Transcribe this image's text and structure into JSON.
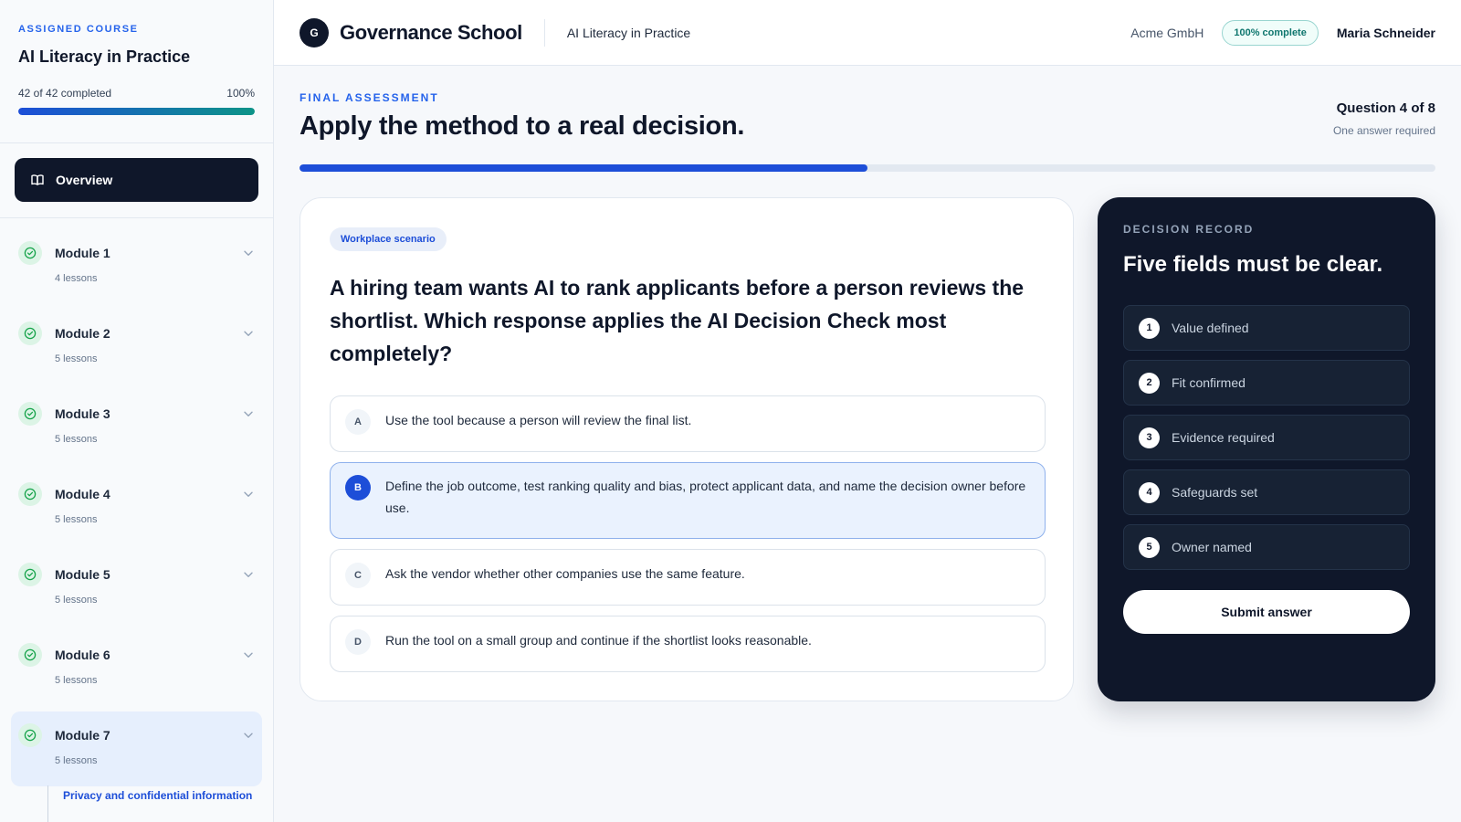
{
  "sidebar": {
    "eyebrow": "ASSIGNED COURSE",
    "course_title": "AI Literacy in Practice",
    "progress_text": "42 of 42 completed",
    "progress_percent_text": "100%",
    "progress_fraction": 1.0,
    "overview_label": "Overview",
    "modules": [
      {
        "title": "Module 1",
        "lessons": "4 lessons"
      },
      {
        "title": "Module 2",
        "lessons": "5 lessons"
      },
      {
        "title": "Module 3",
        "lessons": "5 lessons"
      },
      {
        "title": "Module 4",
        "lessons": "5 lessons"
      },
      {
        "title": "Module 5",
        "lessons": "5 lessons"
      },
      {
        "title": "Module 6",
        "lessons": "5 lessons"
      },
      {
        "title": "Module 7",
        "lessons": "5 lessons"
      }
    ],
    "active_lesson": "Privacy and confidential information"
  },
  "header": {
    "logo_letter": "G",
    "brand": "Governance School",
    "course": "AI Literacy in Practice",
    "org": "Acme GmbH",
    "badge": "100% complete",
    "user": "Maria Schneider"
  },
  "assessment": {
    "eyebrow": "FINAL ASSESSMENT",
    "title": "Apply the method to a real decision.",
    "counter": "Question 4 of 8",
    "note": "One answer required",
    "progress_fraction": 0.5
  },
  "question": {
    "tag": "Workplace scenario",
    "text": "A hiring team wants AI to rank applicants before a person reviews the shortlist. Which response applies the AI Decision Check most completely?",
    "options": [
      {
        "letter": "A",
        "text": "Use the tool because a person will review the final list."
      },
      {
        "letter": "B",
        "text": "Define the job outcome, test ranking quality and bias, protect applicant data, and name the decision owner before use."
      },
      {
        "letter": "C",
        "text": "Ask the vendor whether other companies use the same feature."
      },
      {
        "letter": "D",
        "text": "Run the tool on a small group and continue if the shortlist looks reasonable."
      }
    ],
    "selected": "B"
  },
  "record": {
    "eyebrow": "DECISION RECORD",
    "title": "Five fields must be clear.",
    "fields": [
      {
        "num": "1",
        "label": "Value defined"
      },
      {
        "num": "2",
        "label": "Fit confirmed"
      },
      {
        "num": "3",
        "label": "Evidence required"
      },
      {
        "num": "4",
        "label": "Safeguards set"
      },
      {
        "num": "5",
        "label": "Owner named"
      }
    ],
    "submit_label": "Submit answer"
  }
}
